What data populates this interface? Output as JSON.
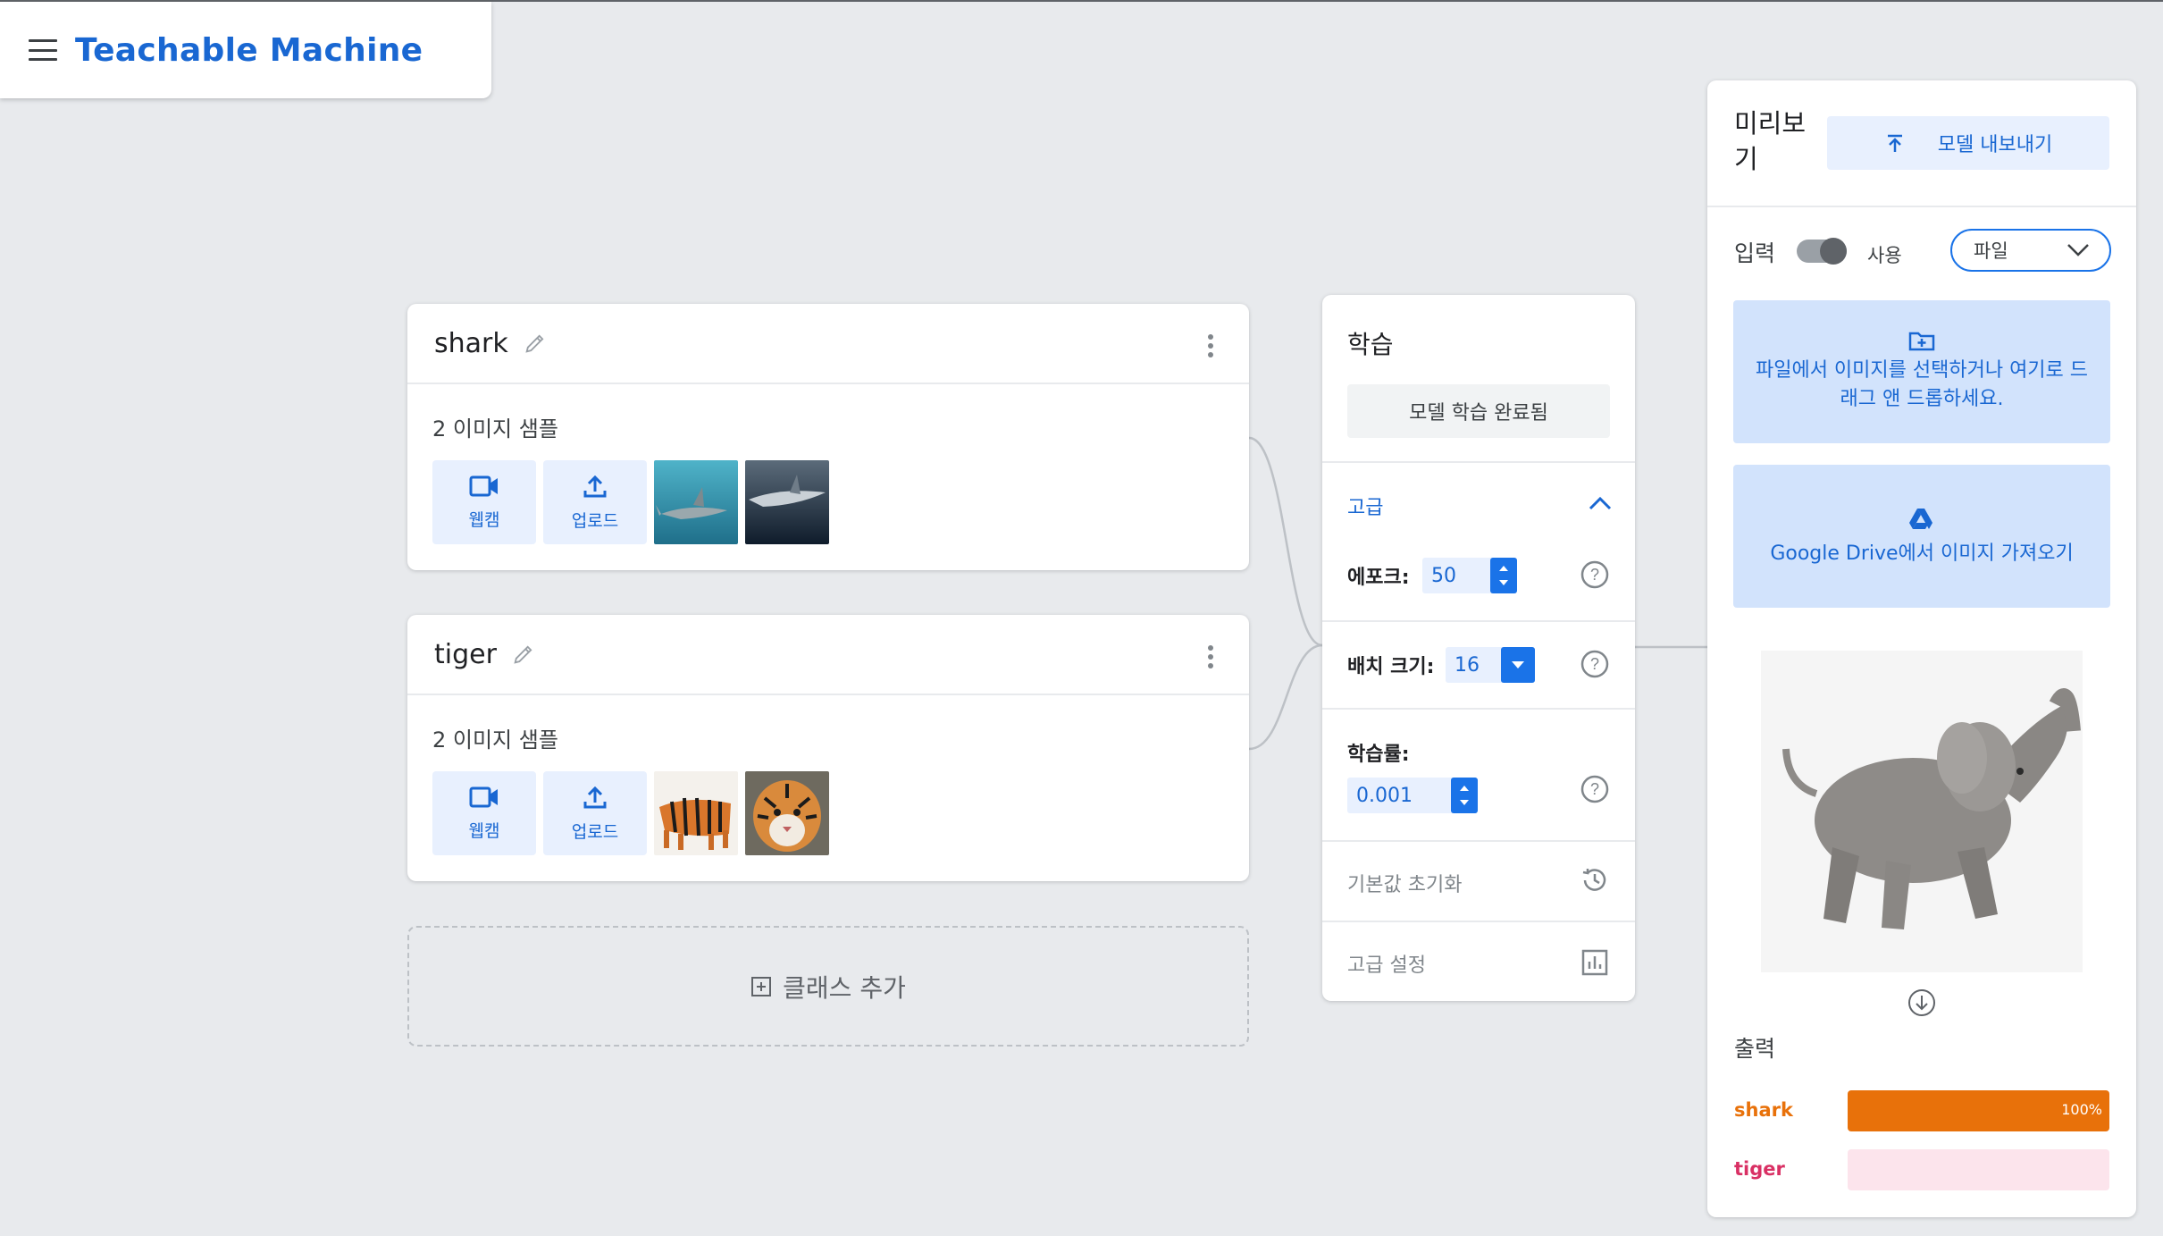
{
  "app": {
    "title": "Teachable Machine"
  },
  "classes": [
    {
      "name": "shark",
      "sample_count": "2 이미지 샘플",
      "webcam_label": "웹캠",
      "upload_label": "업로드",
      "thumbnails": [
        "shark-image-1",
        "shark-image-2"
      ]
    },
    {
      "name": "tiger",
      "sample_count": "2 이미지 샘플",
      "webcam_label": "웹캠",
      "upload_label": "업로드",
      "thumbnails": [
        "tiger-image-1",
        "tiger-image-2"
      ]
    }
  ],
  "add_class_label": "클래스 추가",
  "training": {
    "title": "학습",
    "status_button": "모델 학습 완료됨",
    "advanced_label": "고급",
    "epochs_label": "에포크:",
    "epochs_value": "50",
    "batch_label": "배치 크기:",
    "batch_value": "16",
    "lr_label": "학습률:",
    "lr_value": "0.001",
    "reset_label": "기본값 초기화",
    "advanced_settings_label": "고급 설정"
  },
  "preview": {
    "title": "미리보기",
    "export_label": "모델 내보내기",
    "input_label": "입력",
    "toggle_label": "사용",
    "source_select": "파일",
    "drop_text": "파일에서 이미지를 선택하거나 여기로 드래그 앤 드롭하세요.",
    "drive_text": "Google Drive에서 이미지 가져오기",
    "output_label": "출력",
    "outputs": [
      {
        "name": "shark",
        "percent_text": "100%",
        "percent": 100,
        "color": "#e8710a",
        "track": "#fde5d2"
      },
      {
        "name": "tiger",
        "percent_text": "",
        "percent": 0,
        "color": "#d93064",
        "track": "#fce4ec"
      }
    ]
  },
  "colors": {
    "accent": "#1967d2",
    "button_bg": "#e8f0fe",
    "drop_bg": "#d2e3fc",
    "spin": "#1a73e8"
  }
}
